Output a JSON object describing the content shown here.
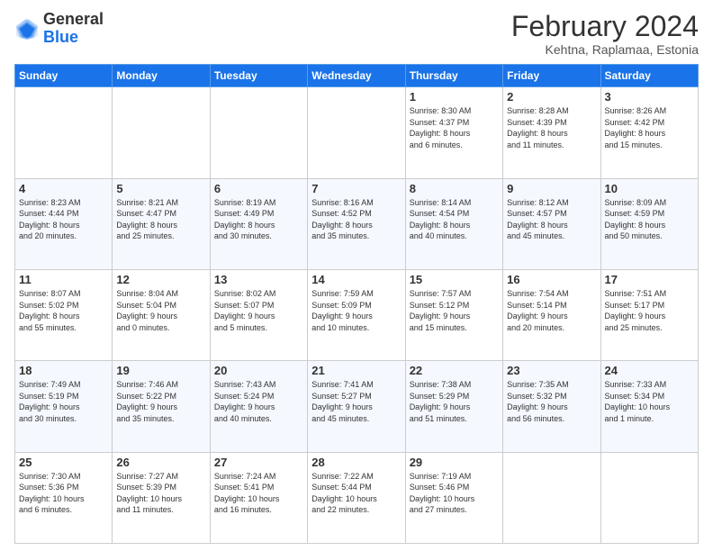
{
  "header": {
    "logo": {
      "general": "General",
      "blue": "Blue"
    },
    "title": "February 2024",
    "subtitle": "Kehtna, Raplamaa, Estonia"
  },
  "calendar": {
    "days_of_week": [
      "Sunday",
      "Monday",
      "Tuesday",
      "Wednesday",
      "Thursday",
      "Friday",
      "Saturday"
    ],
    "weeks": [
      [
        {
          "day": "",
          "info": ""
        },
        {
          "day": "",
          "info": ""
        },
        {
          "day": "",
          "info": ""
        },
        {
          "day": "",
          "info": ""
        },
        {
          "day": "1",
          "info": "Sunrise: 8:30 AM\nSunset: 4:37 PM\nDaylight: 8 hours\nand 6 minutes."
        },
        {
          "day": "2",
          "info": "Sunrise: 8:28 AM\nSunset: 4:39 PM\nDaylight: 8 hours\nand 11 minutes."
        },
        {
          "day": "3",
          "info": "Sunrise: 8:26 AM\nSunset: 4:42 PM\nDaylight: 8 hours\nand 15 minutes."
        }
      ],
      [
        {
          "day": "4",
          "info": "Sunrise: 8:23 AM\nSunset: 4:44 PM\nDaylight: 8 hours\nand 20 minutes."
        },
        {
          "day": "5",
          "info": "Sunrise: 8:21 AM\nSunset: 4:47 PM\nDaylight: 8 hours\nand 25 minutes."
        },
        {
          "day": "6",
          "info": "Sunrise: 8:19 AM\nSunset: 4:49 PM\nDaylight: 8 hours\nand 30 minutes."
        },
        {
          "day": "7",
          "info": "Sunrise: 8:16 AM\nSunset: 4:52 PM\nDaylight: 8 hours\nand 35 minutes."
        },
        {
          "day": "8",
          "info": "Sunrise: 8:14 AM\nSunset: 4:54 PM\nDaylight: 8 hours\nand 40 minutes."
        },
        {
          "day": "9",
          "info": "Sunrise: 8:12 AM\nSunset: 4:57 PM\nDaylight: 8 hours\nand 45 minutes."
        },
        {
          "day": "10",
          "info": "Sunrise: 8:09 AM\nSunset: 4:59 PM\nDaylight: 8 hours\nand 50 minutes."
        }
      ],
      [
        {
          "day": "11",
          "info": "Sunrise: 8:07 AM\nSunset: 5:02 PM\nDaylight: 8 hours\nand 55 minutes."
        },
        {
          "day": "12",
          "info": "Sunrise: 8:04 AM\nSunset: 5:04 PM\nDaylight: 9 hours\nand 0 minutes."
        },
        {
          "day": "13",
          "info": "Sunrise: 8:02 AM\nSunset: 5:07 PM\nDaylight: 9 hours\nand 5 minutes."
        },
        {
          "day": "14",
          "info": "Sunrise: 7:59 AM\nSunset: 5:09 PM\nDaylight: 9 hours\nand 10 minutes."
        },
        {
          "day": "15",
          "info": "Sunrise: 7:57 AM\nSunset: 5:12 PM\nDaylight: 9 hours\nand 15 minutes."
        },
        {
          "day": "16",
          "info": "Sunrise: 7:54 AM\nSunset: 5:14 PM\nDaylight: 9 hours\nand 20 minutes."
        },
        {
          "day": "17",
          "info": "Sunrise: 7:51 AM\nSunset: 5:17 PM\nDaylight: 9 hours\nand 25 minutes."
        }
      ],
      [
        {
          "day": "18",
          "info": "Sunrise: 7:49 AM\nSunset: 5:19 PM\nDaylight: 9 hours\nand 30 minutes."
        },
        {
          "day": "19",
          "info": "Sunrise: 7:46 AM\nSunset: 5:22 PM\nDaylight: 9 hours\nand 35 minutes."
        },
        {
          "day": "20",
          "info": "Sunrise: 7:43 AM\nSunset: 5:24 PM\nDaylight: 9 hours\nand 40 minutes."
        },
        {
          "day": "21",
          "info": "Sunrise: 7:41 AM\nSunset: 5:27 PM\nDaylight: 9 hours\nand 45 minutes."
        },
        {
          "day": "22",
          "info": "Sunrise: 7:38 AM\nSunset: 5:29 PM\nDaylight: 9 hours\nand 51 minutes."
        },
        {
          "day": "23",
          "info": "Sunrise: 7:35 AM\nSunset: 5:32 PM\nDaylight: 9 hours\nand 56 minutes."
        },
        {
          "day": "24",
          "info": "Sunrise: 7:33 AM\nSunset: 5:34 PM\nDaylight: 10 hours\nand 1 minute."
        }
      ],
      [
        {
          "day": "25",
          "info": "Sunrise: 7:30 AM\nSunset: 5:36 PM\nDaylight: 10 hours\nand 6 minutes."
        },
        {
          "day": "26",
          "info": "Sunrise: 7:27 AM\nSunset: 5:39 PM\nDaylight: 10 hours\nand 11 minutes."
        },
        {
          "day": "27",
          "info": "Sunrise: 7:24 AM\nSunset: 5:41 PM\nDaylight: 10 hours\nand 16 minutes."
        },
        {
          "day": "28",
          "info": "Sunrise: 7:22 AM\nSunset: 5:44 PM\nDaylight: 10 hours\nand 22 minutes."
        },
        {
          "day": "29",
          "info": "Sunrise: 7:19 AM\nSunset: 5:46 PM\nDaylight: 10 hours\nand 27 minutes."
        },
        {
          "day": "",
          "info": ""
        },
        {
          "day": "",
          "info": ""
        }
      ]
    ]
  }
}
